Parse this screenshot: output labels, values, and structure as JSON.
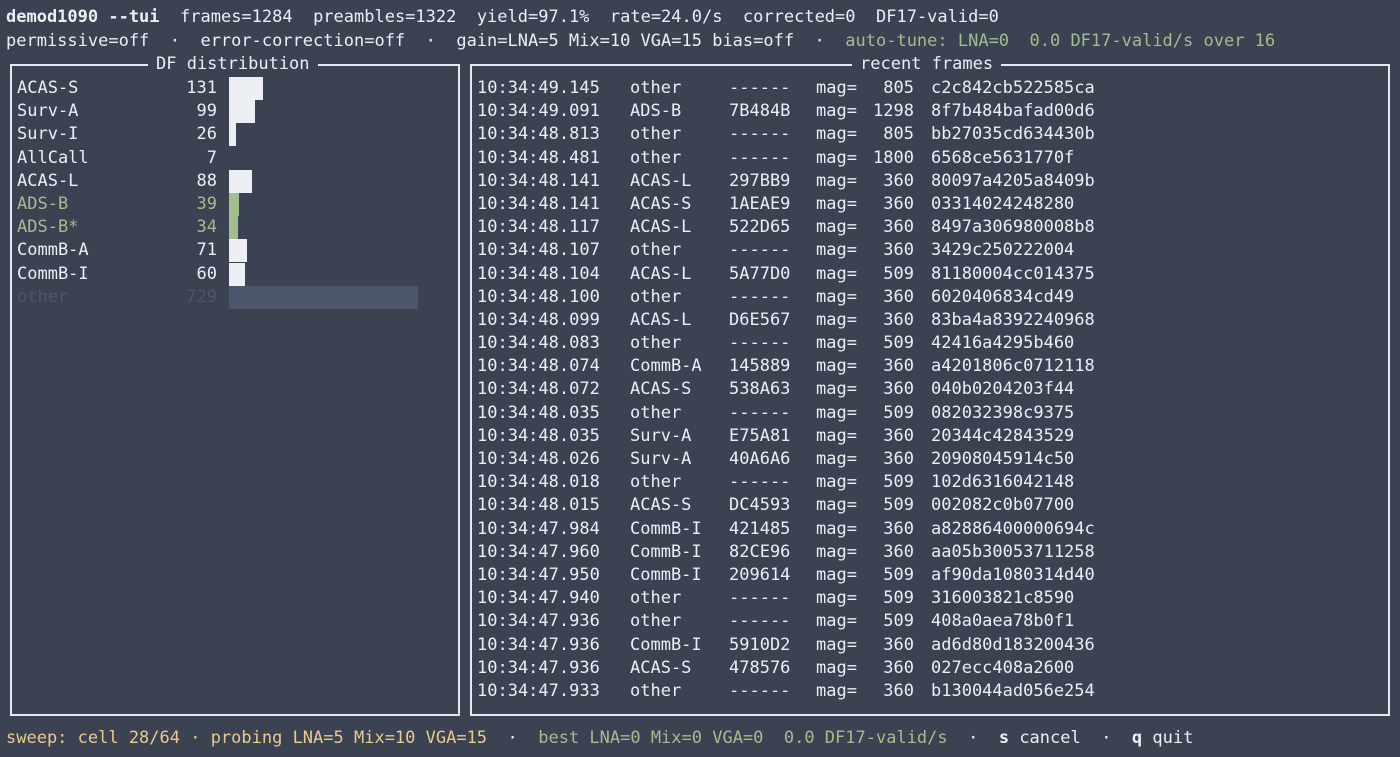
{
  "header": {
    "app": "demod1090 --tui",
    "stats": "frames=1284  preambles=1322  yield=97.1%  rate=24.0/s  corrected=0  DF17-valid=0",
    "settings": "permissive=off  ·  error-correction=off  ·  gain=LNA=5 Mix=10 VGA=15 bias=off  · ",
    "autotune": "auto-tune: LNA=0  0.0 DF17-valid/s over 16"
  },
  "df_panel": {
    "title": "DF distribution",
    "rows": [
      {
        "label": "ACAS-S",
        "count": "131",
        "bar": 131
      },
      {
        "label": "Surv-A",
        "count": "99",
        "bar": 99
      },
      {
        "label": "Surv-I",
        "count": "26",
        "bar": 26
      },
      {
        "label": "AllCall",
        "count": "7",
        "bar": 7
      },
      {
        "label": "ACAS-L",
        "count": "88",
        "bar": 88
      },
      {
        "label": "ADS-B",
        "count": "39",
        "bar": 39
      },
      {
        "label": "ADS-B*",
        "count": "34",
        "bar": 34
      },
      {
        "label": "CommB-A",
        "count": "71",
        "bar": 71
      },
      {
        "label": "CommB-I",
        "count": "60",
        "bar": 60
      },
      {
        "label": "other",
        "count": "729",
        "bar": 729
      }
    ]
  },
  "rf_panel": {
    "title": "recent frames",
    "mag_label": "mag=",
    "rows": [
      {
        "time": "10:34:49.145",
        "type": "other",
        "icao": "------",
        "mag": "805",
        "hex": "c2c842cb522585ca"
      },
      {
        "time": "10:34:49.091",
        "type": "ADS-B",
        "icao": "7B484B",
        "mag": "1298",
        "hex": "8f7b484bafad00d6"
      },
      {
        "time": "10:34:48.813",
        "type": "other",
        "icao": "------",
        "mag": "805",
        "hex": "bb27035cd634430b"
      },
      {
        "time": "10:34:48.481",
        "type": "other",
        "icao": "------",
        "mag": "1800",
        "hex": "6568ce5631770f"
      },
      {
        "time": "10:34:48.141",
        "type": "ACAS-L",
        "icao": "297BB9",
        "mag": "360",
        "hex": "80097a4205a8409b"
      },
      {
        "time": "10:34:48.141",
        "type": "ACAS-S",
        "icao": "1AEAE9",
        "mag": "360",
        "hex": "03314024248280"
      },
      {
        "time": "10:34:48.117",
        "type": "ACAS-L",
        "icao": "522D65",
        "mag": "360",
        "hex": "8497a306980008b8"
      },
      {
        "time": "10:34:48.107",
        "type": "other",
        "icao": "------",
        "mag": "360",
        "hex": "3429c250222004"
      },
      {
        "time": "10:34:48.104",
        "type": "ACAS-L",
        "icao": "5A77D0",
        "mag": "509",
        "hex": "81180004cc014375"
      },
      {
        "time": "10:34:48.100",
        "type": "other",
        "icao": "------",
        "mag": "360",
        "hex": "6020406834cd49"
      },
      {
        "time": "10:34:48.099",
        "type": "ACAS-L",
        "icao": "D6E567",
        "mag": "360",
        "hex": "83ba4a8392240968"
      },
      {
        "time": "10:34:48.083",
        "type": "other",
        "icao": "------",
        "mag": "509",
        "hex": "42416a4295b460"
      },
      {
        "time": "10:34:48.074",
        "type": "CommB-A",
        "icao": "145889",
        "mag": "360",
        "hex": "a4201806c0712118"
      },
      {
        "time": "10:34:48.072",
        "type": "ACAS-S",
        "icao": "538A63",
        "mag": "360",
        "hex": "040b0204203f44"
      },
      {
        "time": "10:34:48.035",
        "type": "other",
        "icao": "------",
        "mag": "509",
        "hex": "082032398c9375"
      },
      {
        "time": "10:34:48.035",
        "type": "Surv-A",
        "icao": "E75A81",
        "mag": "360",
        "hex": "20344c42843529"
      },
      {
        "time": "10:34:48.026",
        "type": "Surv-A",
        "icao": "40A6A6",
        "mag": "360",
        "hex": "20908045914c50"
      },
      {
        "time": "10:34:48.018",
        "type": "other",
        "icao": "------",
        "mag": "509",
        "hex": "102d6316042148"
      },
      {
        "time": "10:34:48.015",
        "type": "ACAS-S",
        "icao": "DC4593",
        "mag": "509",
        "hex": "002082c0b07700"
      },
      {
        "time": "10:34:47.984",
        "type": "CommB-I",
        "icao": "421485",
        "mag": "360",
        "hex": "a82886400000694c"
      },
      {
        "time": "10:34:47.960",
        "type": "CommB-I",
        "icao": "82CE96",
        "mag": "360",
        "hex": "aa05b30053711258"
      },
      {
        "time": "10:34:47.950",
        "type": "CommB-I",
        "icao": "209614",
        "mag": "509",
        "hex": "af90da1080314d40"
      },
      {
        "time": "10:34:47.940",
        "type": "other",
        "icao": "------",
        "mag": "509",
        "hex": "316003821c8590"
      },
      {
        "time": "10:34:47.936",
        "type": "other",
        "icao": "------",
        "mag": "509",
        "hex": "408a0aea78b0f1"
      },
      {
        "time": "10:34:47.936",
        "type": "CommB-I",
        "icao": "5910D2",
        "mag": "360",
        "hex": "ad6d80d183200436"
      },
      {
        "time": "10:34:47.936",
        "type": "ACAS-S",
        "icao": "478576",
        "mag": "360",
        "hex": "027ecc408a2600"
      },
      {
        "time": "10:34:47.933",
        "type": "other",
        "icao": "------",
        "mag": "360",
        "hex": "b130044ad056e254"
      }
    ]
  },
  "status": {
    "sweep": "sweep: cell 28/64 · probing LNA=5 Mix=10 VGA=15",
    "sep1": "  ·  ",
    "best": "best LNA=0 Mix=0 VGA=0  0.0 DF17-valid/s",
    "sep2": "  ·  ",
    "cancel_key": "s",
    "cancel_label": " cancel",
    "sep3": "  ·  ",
    "quit_key": "q",
    "quit_label": " quit"
  }
}
